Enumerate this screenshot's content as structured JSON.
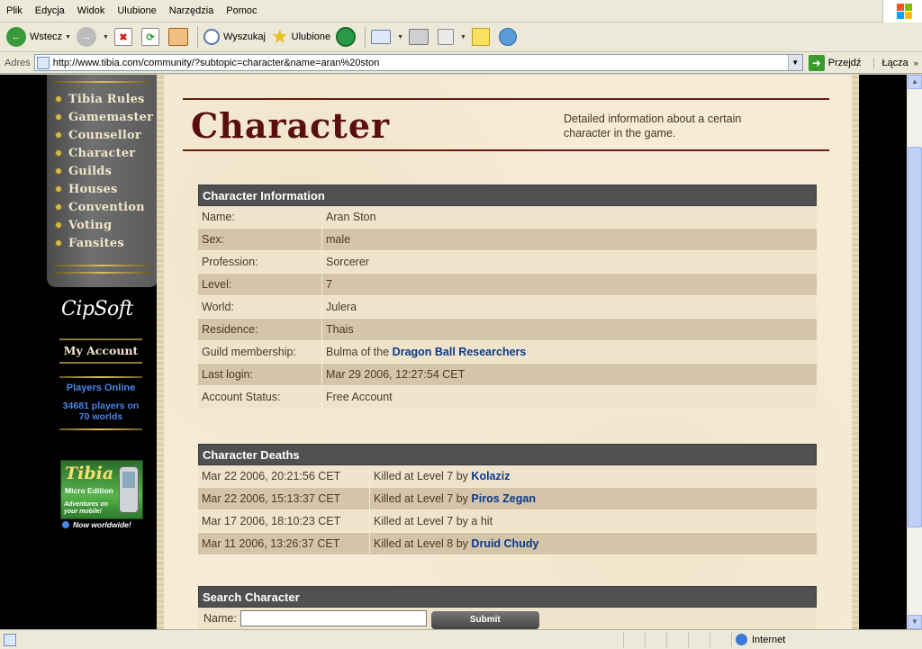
{
  "browser": {
    "menu": [
      "Plik",
      "Edycja",
      "Widok",
      "Ulubione",
      "Narzędzia",
      "Pomoc"
    ],
    "toolbar": {
      "back_label": "Wstecz",
      "search_label": "Wyszukaj",
      "favorites_label": "Ulubione"
    },
    "address": {
      "label": "Adres",
      "url": "http://www.tibia.com/community/?subtopic=character&name=aran%20ston",
      "go_label": "Przejdź",
      "links_label": "Łącza"
    },
    "status": {
      "zone": "Internet"
    }
  },
  "site": {
    "nav": [
      "Tibia Rules",
      "Gamemaster",
      "Counsellor",
      "Character",
      "Guilds",
      "Houses",
      "Convention",
      "Voting",
      "Fansites"
    ],
    "cipsoft": "CipSoft",
    "my_account": "My Account",
    "players_online_title": "Players Online",
    "players_online_text": "34681 players on 70 worlds",
    "ad": {
      "title": "Tibia",
      "subtitle": "Micro Edition",
      "tagline": "Adventures on your mobile!",
      "worldwide": "Now worldwide!"
    }
  },
  "page": {
    "title": "Character",
    "description": "Detailed information about a certain character in the game."
  },
  "character_info": {
    "heading": "Character Information",
    "rows": [
      {
        "label": "Name:",
        "value": "Aran Ston"
      },
      {
        "label": "Sex:",
        "value": "male"
      },
      {
        "label": "Profession:",
        "value": "Sorcerer"
      },
      {
        "label": "Level:",
        "value": "7"
      },
      {
        "label": "World:",
        "value": "Julera"
      },
      {
        "label": "Residence:",
        "value": "Thais"
      },
      {
        "label": "Guild membership:",
        "value": "Bulma of the",
        "link": "Dragon Ball Researchers"
      },
      {
        "label": "Last login:",
        "value": "Mar 29 2006, 12:27:54 CET"
      },
      {
        "label": "Account Status:",
        "value": "Free Account"
      }
    ]
  },
  "character_deaths": {
    "heading": "Character Deaths",
    "rows": [
      {
        "date": "Mar 22 2006, 20:21:56 CET",
        "text": "Killed at Level 7 by",
        "killer": "Kolaziz",
        "killer_link": true
      },
      {
        "date": "Mar 22 2006, 15:13:37 CET",
        "text": "Killed at Level 7 by",
        "killer": "Piros Zegan",
        "killer_link": true
      },
      {
        "date": "Mar 17 2006, 18:10:23 CET",
        "text": "Killed at Level 7 by",
        "killer": "a hit",
        "killer_link": false
      },
      {
        "date": "Mar 11 2006, 13:26:37 CET",
        "text": "Killed at Level 8 by",
        "killer": "Druid Chudy",
        "killer_link": true
      }
    ]
  },
  "search_character": {
    "heading": "Search Character",
    "name_label": "Name:",
    "name_value": "",
    "submit_label": "Submit"
  },
  "colors": {
    "header_bar": "#505050",
    "link": "#0a3a8a",
    "title": "#5a0f0f",
    "row_light": "#efe3cb",
    "row_dark": "#d4c4a8"
  }
}
